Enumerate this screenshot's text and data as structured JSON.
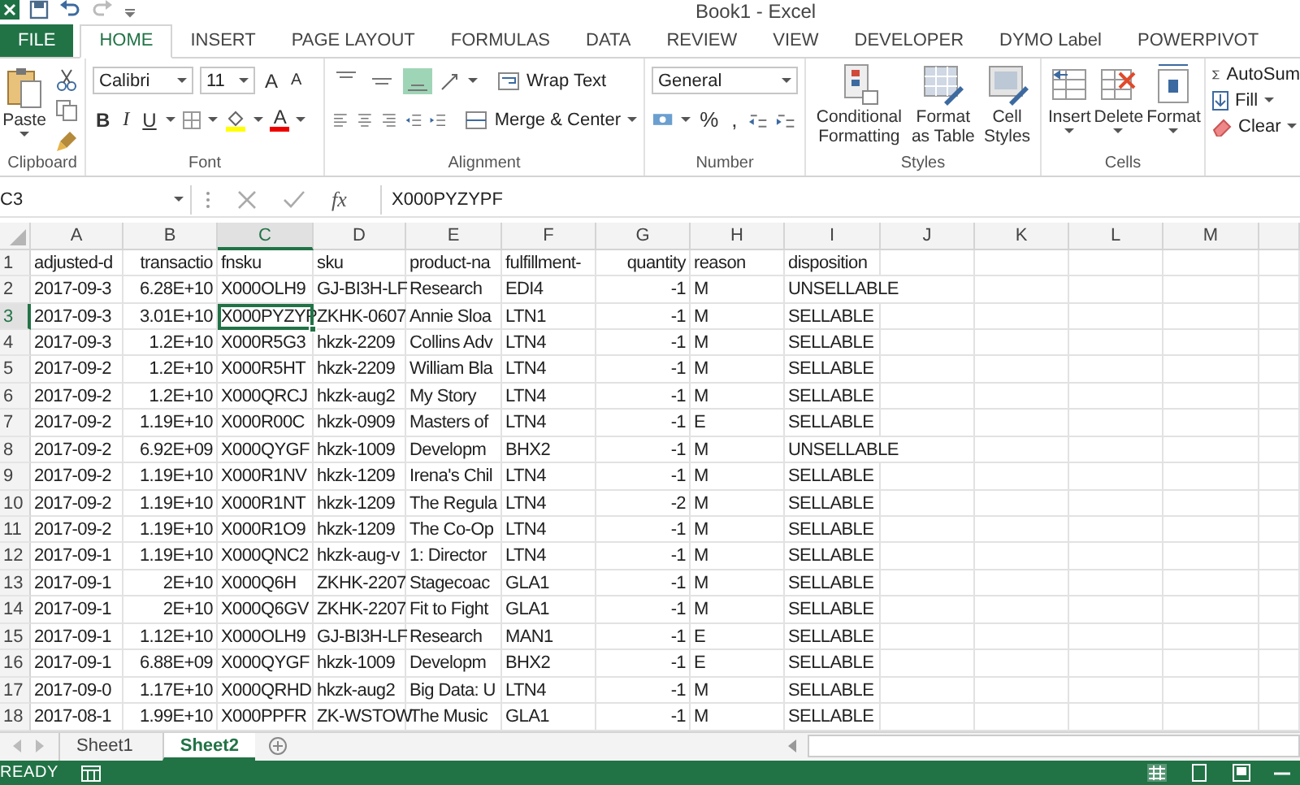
{
  "window": {
    "title": "Book1 - Excel"
  },
  "tabs": [
    {
      "label": "FILE",
      "kind": "file",
      "selected": false
    },
    {
      "label": "HOME",
      "kind": "tab",
      "selected": true
    },
    {
      "label": "INSERT",
      "kind": "tab",
      "selected": false
    },
    {
      "label": "PAGE LAYOUT",
      "kind": "tab",
      "selected": false
    },
    {
      "label": "FORMULAS",
      "kind": "tab",
      "selected": false
    },
    {
      "label": "DATA",
      "kind": "tab",
      "selected": false
    },
    {
      "label": "REVIEW",
      "kind": "tab",
      "selected": false
    },
    {
      "label": "VIEW",
      "kind": "tab",
      "selected": false
    },
    {
      "label": "DEVELOPER",
      "kind": "tab",
      "selected": false
    },
    {
      "label": "DYMO Label",
      "kind": "tab",
      "selected": false
    },
    {
      "label": "POWERPIVOT",
      "kind": "tab",
      "selected": false
    }
  ],
  "ribbon": {
    "clipboard": {
      "label": "Clipboard",
      "paste": "Paste"
    },
    "font": {
      "label": "Font",
      "name": "Calibri",
      "size": "11",
      "grow": "A",
      "shrink": "A",
      "bold": "B",
      "italic": "I",
      "underline": "U",
      "text_color_button": "A"
    },
    "alignment": {
      "label": "Alignment",
      "vertical_align": [
        {
          "selected": false
        },
        {
          "selected": false
        },
        {
          "selected": true
        }
      ],
      "wrap_text": "Wrap Text",
      "merge_center": "Merge & Center"
    },
    "number": {
      "label": "Number",
      "format": "General",
      "percent": "%",
      "comma": ","
    },
    "styles": {
      "label": "Styles",
      "conditional_formatting": "Conditional Formatting",
      "format_as_table": "Format as Table",
      "cell_styles": "Cell Styles"
    },
    "cells": {
      "label": "Cells",
      "insert": "Insert",
      "delete": "Delete",
      "format": "Format"
    },
    "editing": {
      "autosum": "AutoSum",
      "fill": "Fill",
      "clear": "Clear"
    }
  },
  "formula_bar": {
    "name_box": "C3",
    "function_label": "fx",
    "value": "X000PYZYPF"
  },
  "sheet": {
    "columns": [
      {
        "label": "A",
        "kind": "text",
        "selected": false
      },
      {
        "label": "B",
        "kind": "number",
        "selected": false
      },
      {
        "label": "C",
        "kind": "text",
        "selected": true
      },
      {
        "label": "D",
        "kind": "text",
        "selected": false
      },
      {
        "label": "E",
        "kind": "text",
        "selected": false
      },
      {
        "label": "F",
        "kind": "text",
        "selected": false
      },
      {
        "label": "G",
        "kind": "number",
        "selected": false
      },
      {
        "label": "H",
        "kind": "text",
        "selected": false
      },
      {
        "label": "I",
        "kind": "text",
        "selected": false
      },
      {
        "label": "J",
        "kind": "text",
        "selected": false
      },
      {
        "label": "K",
        "kind": "text",
        "selected": false
      },
      {
        "label": "L",
        "kind": "text",
        "selected": false
      },
      {
        "label": "M",
        "kind": "text",
        "selected": false
      }
    ],
    "rows": [
      {
        "number": "1",
        "selected": false,
        "cells": [
          "adjusted-d",
          "transactio",
          "fnsku",
          "sku",
          "product-na",
          "fulfillment-",
          "quantity",
          "reason",
          "disposition"
        ]
      },
      {
        "number": "2",
        "selected": false,
        "cells": [
          "2017-09-3",
          "6.28E+10",
          "X000OLH9",
          "GJ-BI3H-LF",
          "Research",
          "EDI4",
          "-1",
          "M",
          "UNSELLABLE"
        ]
      },
      {
        "number": "3",
        "selected": true,
        "cells": [
          "2017-09-3",
          "3.01E+10",
          "X000PYZYP",
          "ZKHK-0607",
          "Annie Sloa",
          "LTN1",
          "-1",
          "M",
          "SELLABLE"
        ]
      },
      {
        "number": "4",
        "selected": false,
        "cells": [
          "2017-09-3",
          "1.2E+10",
          "X000R5G3",
          "hkzk-2209",
          "Collins Adv",
          "LTN4",
          "-1",
          "M",
          "SELLABLE"
        ]
      },
      {
        "number": "5",
        "selected": false,
        "cells": [
          "2017-09-2",
          "1.2E+10",
          "X000R5HT",
          "hkzk-2209",
          "William Bla",
          "LTN4",
          "-1",
          "M",
          "SELLABLE"
        ]
      },
      {
        "number": "6",
        "selected": false,
        "cells": [
          "2017-09-2",
          "1.2E+10",
          "X000QRCJ",
          "hkzk-aug2",
          "My Story",
          "LTN4",
          "-1",
          "M",
          "SELLABLE"
        ]
      },
      {
        "number": "7",
        "selected": false,
        "cells": [
          "2017-09-2",
          "1.19E+10",
          "X000R00C",
          "hkzk-0909",
          "Masters of",
          "LTN4",
          "-1",
          "E",
          "SELLABLE"
        ]
      },
      {
        "number": "8",
        "selected": false,
        "cells": [
          "2017-09-2",
          "6.92E+09",
          "X000QYGF",
          "hkzk-1009",
          "Developm",
          "BHX2",
          "-1",
          "M",
          "UNSELLABLE"
        ]
      },
      {
        "number": "9",
        "selected": false,
        "cells": [
          "2017-09-2",
          "1.19E+10",
          "X000R1NV",
          "hkzk-1209",
          "Irena's Chil",
          "LTN4",
          "-1",
          "M",
          "SELLABLE"
        ]
      },
      {
        "number": "10",
        "selected": false,
        "cells": [
          "2017-09-2",
          "1.19E+10",
          "X000R1NT",
          "hkzk-1209",
          "The Regula",
          "LTN4",
          "-2",
          "M",
          "SELLABLE"
        ]
      },
      {
        "number": "11",
        "selected": false,
        "cells": [
          "2017-09-2",
          "1.19E+10",
          "X000R1O9",
          "hkzk-1209",
          "The Co-Op",
          "LTN4",
          "-1",
          "M",
          "SELLABLE"
        ]
      },
      {
        "number": "12",
        "selected": false,
        "cells": [
          "2017-09-1",
          "1.19E+10",
          "X000QNC2",
          "hkzk-aug-v",
          "1: Director",
          "LTN4",
          "-1",
          "M",
          "SELLABLE"
        ]
      },
      {
        "number": "13",
        "selected": false,
        "cells": [
          "2017-09-1",
          "2E+10",
          "X000Q6H",
          "ZKHK-2207",
          "Stagecoac",
          "GLA1",
          "-1",
          "M",
          "SELLABLE"
        ]
      },
      {
        "number": "14",
        "selected": false,
        "cells": [
          "2017-09-1",
          "2E+10",
          "X000Q6GV",
          "ZKHK-2207",
          "Fit to Fight",
          "GLA1",
          "-1",
          "M",
          "SELLABLE"
        ]
      },
      {
        "number": "15",
        "selected": false,
        "cells": [
          "2017-09-1",
          "1.12E+10",
          "X000OLH9",
          "GJ-BI3H-LF",
          "Research",
          "MAN1",
          "-1",
          "E",
          "SELLABLE"
        ]
      },
      {
        "number": "16",
        "selected": false,
        "cells": [
          "2017-09-1",
          "6.88E+09",
          "X000QYGF",
          "hkzk-1009",
          "Developm",
          "BHX2",
          "-1",
          "E",
          "SELLABLE"
        ]
      },
      {
        "number": "17",
        "selected": false,
        "cells": [
          "2017-09-0",
          "1.17E+10",
          "X000QRHD",
          "hkzk-aug2",
          "Big Data: U",
          "LTN4",
          "-1",
          "M",
          "SELLABLE"
        ]
      },
      {
        "number": "18",
        "selected": false,
        "cells": [
          "2017-08-1",
          "1.99E+10",
          "X000PPFR",
          "ZK-WSTOW",
          "The Music",
          "GLA1",
          "-1",
          "M",
          "SELLABLE"
        ]
      }
    ]
  },
  "sheet_tabs": [
    {
      "label": "Sheet1",
      "selected": false
    },
    {
      "label": "Sheet2",
      "selected": true
    }
  ],
  "status_bar": {
    "mode": "READY"
  }
}
